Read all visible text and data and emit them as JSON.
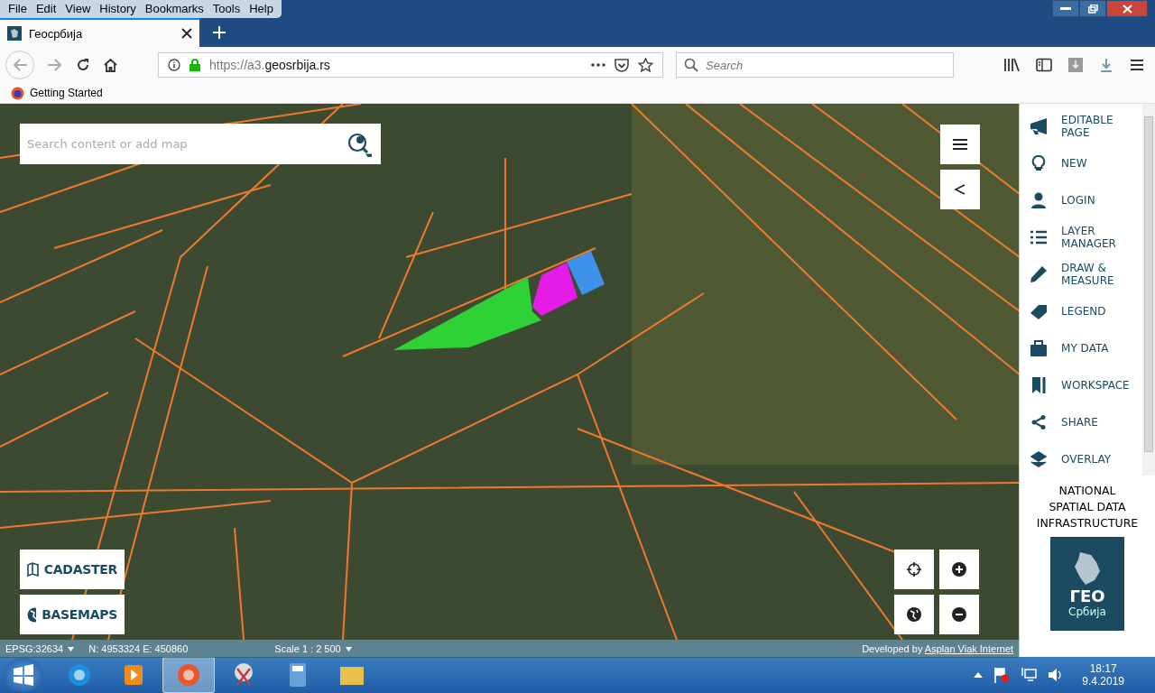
{
  "browser": {
    "menu": [
      "File",
      "Edit",
      "View",
      "History",
      "Bookmarks",
      "Tools",
      "Help"
    ],
    "tab": {
      "title": "Геосрбија",
      "selected": true
    },
    "url": {
      "scheme": "https://a3.",
      "domain": "geosrbija.rs"
    },
    "search": {
      "placeholder": "Search"
    },
    "bookmarks": [
      "Getting Started"
    ]
  },
  "map": {
    "search": {
      "placeholder": "Search content or add map"
    },
    "parcels": [
      {
        "color": "#2ed136"
      },
      {
        "color": "#e51ce8"
      },
      {
        "color": "#3f92ec"
      }
    ],
    "layer_buttons": [
      {
        "kind": "cadaster",
        "label": "CADASTER"
      },
      {
        "kind": "basemaps",
        "label": "BASEMAPS"
      }
    ],
    "status_bar": {
      "projection": "EPSG:32634",
      "coordinates": "N: 4953324 E: 450860",
      "scale": "Scale 1 : 2 500",
      "credit": "Developed by",
      "credit_link": "Asplan Viak Internet"
    }
  },
  "sidebar": {
    "items": [
      {
        "label": "EDITABLE PAGE"
      },
      {
        "label": "NEW"
      },
      {
        "label": "LOGIN"
      },
      {
        "label": "LAYER MANAGER"
      },
      {
        "label": "DRAW & MEASURE"
      },
      {
        "label": "LEGEND"
      },
      {
        "label": "MY DATA"
      },
      {
        "label": "WORKSPACE"
      },
      {
        "label": "SHARE"
      },
      {
        "label": "OVERLAY"
      }
    ],
    "caption": "NATIONAL SPATIAL DATA INFRASTRUCTURE",
    "logo": {
      "title": "ГЕО",
      "subtitle": "Србија"
    }
  },
  "taskbar": {
    "apps": [
      {
        "kind": "ie",
        "selected": false
      },
      {
        "kind": "media",
        "selected": false
      },
      {
        "kind": "firefox",
        "selected": true
      },
      {
        "kind": "snip",
        "selected": false
      },
      {
        "kind": "calc",
        "selected": false
      },
      {
        "kind": "folder",
        "selected": false
      }
    ],
    "time": "18:17",
    "date": "9.4.2019"
  }
}
